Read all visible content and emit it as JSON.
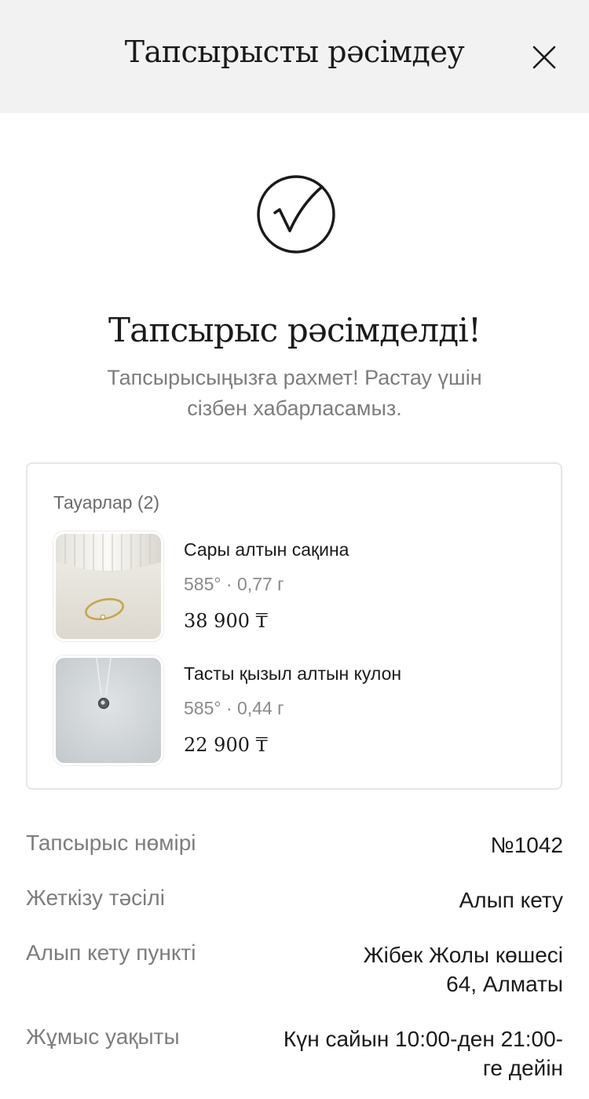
{
  "header": {
    "title": "Тапсырысты рәсімдеу",
    "close_icon": "close-icon"
  },
  "success": {
    "icon": "check-circle-icon",
    "title": "Тапсырыс рәсімделді!",
    "subtitle": "Тапсырысыңызға рахмет! Растау үшін сізбен хабарласамыз."
  },
  "items": {
    "heading": "Тауарлар (2)",
    "list": [
      {
        "name": "Сары алтын сақина",
        "meta": "585° · 0,77 г",
        "price": "38 900 ₸",
        "image": "gold-ring-photo"
      },
      {
        "name": "Тасты қызыл алтын кулон",
        "meta": "585° · 0,44 г",
        "price": "22 900 ₸",
        "image": "pendant-photo"
      }
    ]
  },
  "details": {
    "order_number": {
      "label": "Тапсырыс нөмірі",
      "value": "№1042"
    },
    "delivery": {
      "label": "Жеткізу тәсілі",
      "value": "Алып кету"
    },
    "pickup_point": {
      "label": "Алып кету пункті",
      "value_line1": "Жібек Жолы көшесі",
      "value_line2": "64, Алматы"
    },
    "hours": {
      "label": "Жұмыс уақыты",
      "value_line1": "Күн сайын 10:00-ден 21:00-",
      "value_line2": "ге дейін"
    }
  },
  "colors": {
    "header_bg": "#f2f2f2",
    "text_primary": "#1a1a1a",
    "text_secondary": "#7d7d7d",
    "border": "#e6e6e6"
  }
}
